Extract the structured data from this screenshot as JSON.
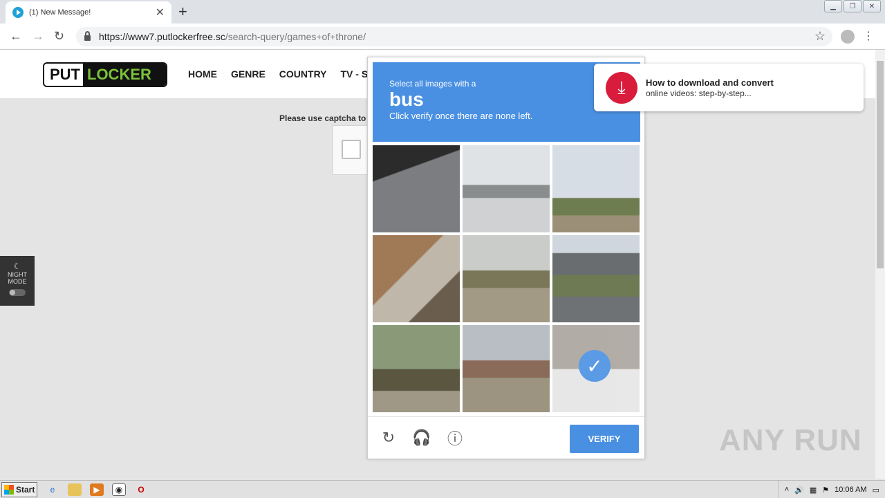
{
  "browser": {
    "tab_title": "(1) New Message!",
    "url_host": "https://www7.putlockerfree.sc",
    "url_path": "/search-query/games+of+throne/"
  },
  "site": {
    "logo_put": "PUT",
    "logo_locker": "LOCKER",
    "nav": [
      "HOME",
      "GENRE",
      "COUNTRY",
      "TV - SER"
    ],
    "captcha_note": "Please use captcha to",
    "night_mode_label_1": "NIGHT",
    "night_mode_label_2": "MODE"
  },
  "captcha": {
    "instruction_pre": "Select all images with a",
    "target_word": "bus",
    "instruction_post": "Click verify once there are none left.",
    "verify_label": "VERIFY",
    "tiles": [
      {
        "selected": false
      },
      {
        "selected": false
      },
      {
        "selected": false
      },
      {
        "selected": false
      },
      {
        "selected": false
      },
      {
        "selected": false
      },
      {
        "selected": false
      },
      {
        "selected": false
      },
      {
        "selected": true
      }
    ]
  },
  "notification": {
    "title": "How to download and convert",
    "body": "online videos: step-by-step..."
  },
  "watermark": "ANY RUN",
  "taskbar": {
    "start_label": "Start",
    "time": "10:06 AM"
  }
}
